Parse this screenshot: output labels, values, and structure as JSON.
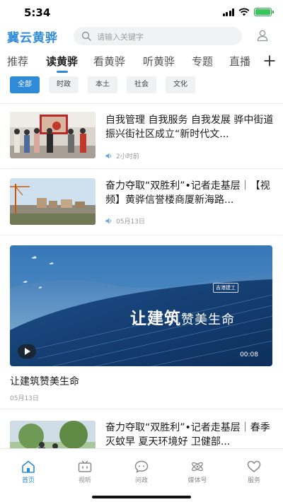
{
  "status_bar": {
    "time": "5:34"
  },
  "header": {
    "logo": "冀云黄骅",
    "search_placeholder": "请输入关键字"
  },
  "tabs": [
    {
      "label": "推荐"
    },
    {
      "label": "读黄骅",
      "active": true
    },
    {
      "label": "看黄骅"
    },
    {
      "label": "听黄骅"
    },
    {
      "label": "专题"
    },
    {
      "label": "直播"
    }
  ],
  "chips": [
    {
      "label": "全部",
      "active": true
    },
    {
      "label": "时政"
    },
    {
      "label": "本土"
    },
    {
      "label": "社会"
    },
    {
      "label": "文化"
    }
  ],
  "news": [
    {
      "title": "自我管理 自我服务 自我发展 骅中街道振兴街社区成立“新时代文...",
      "meta": "2小时前"
    },
    {
      "title": "奋力夺取“双胜利”•记者走基层｜【视频】黄骅信誉楼商厦新海路...",
      "meta": "05月13日"
    },
    {
      "title": "奋力夺取“双胜利”•记者走基层｜春季灭蚊早 夏天环境好 卫健部...",
      "meta": ""
    }
  ],
  "video": {
    "title": "让建筑赞美生命",
    "date": "05月13日",
    "duration": "00:08",
    "caption_big": "让建筑",
    "caption_small": "赞美生命",
    "logo_text": "吉港建工"
  },
  "bottom_nav": [
    {
      "label": "首页",
      "icon": "home-icon",
      "active": true
    },
    {
      "label": "视听",
      "icon": "tv-icon"
    },
    {
      "label": "问政",
      "icon": "chat-bubble-icon"
    },
    {
      "label": "媒体号",
      "icon": "atom-icon"
    },
    {
      "label": "服务",
      "icon": "heart-icon"
    }
  ],
  "colors": {
    "accent": "#2f8ad8",
    "text": "#1a1a1a",
    "muted": "#999999"
  }
}
